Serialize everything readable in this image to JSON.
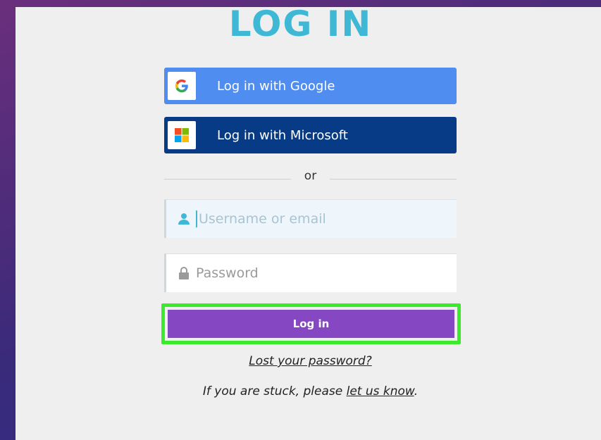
{
  "title": "LOG IN",
  "sso": {
    "google_label": "Log in with Google",
    "microsoft_label": "Log in with Microsoft"
  },
  "divider": {
    "text": "or"
  },
  "username": {
    "placeholder": "Username or email",
    "value": ""
  },
  "password": {
    "placeholder": "Password",
    "value": ""
  },
  "login_button": {
    "label": "Log in"
  },
  "links": {
    "lost_password": "Lost your password?",
    "stuck_prefix": "If you are stuck, please ",
    "stuck_link": "let us know",
    "stuck_suffix": "."
  },
  "colors": {
    "title": "#3fb8d6",
    "google_button": "#4f8df0",
    "microsoft_button": "#073b86",
    "login_button": "#8547c2",
    "highlight": "#3bea2b"
  },
  "icons": {
    "google": "google-icon",
    "microsoft": "microsoft-icon",
    "user": "user-icon",
    "lock": "lock-icon"
  }
}
